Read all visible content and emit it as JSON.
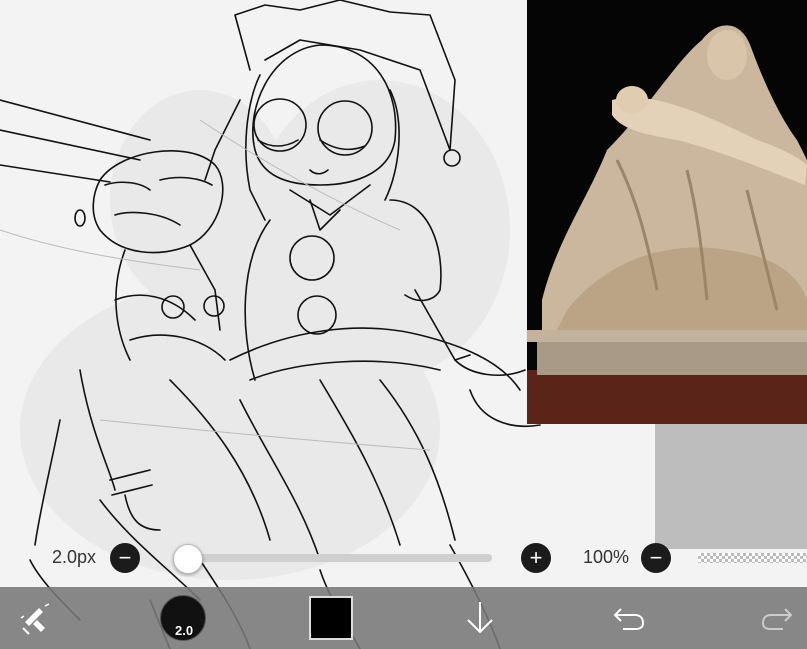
{
  "brush": {
    "size_label": "2.0px",
    "size_value": "2.0"
  },
  "opacity": {
    "label": "100%"
  },
  "color": {
    "current": "#000000"
  },
  "icons": {
    "brush_tool": "pencil-eraser-icon",
    "undo": "undo-icon",
    "redo": "redo-icon",
    "layer_down": "arrow-down-icon",
    "minus": "minus-icon",
    "plus": "plus-icon"
  }
}
